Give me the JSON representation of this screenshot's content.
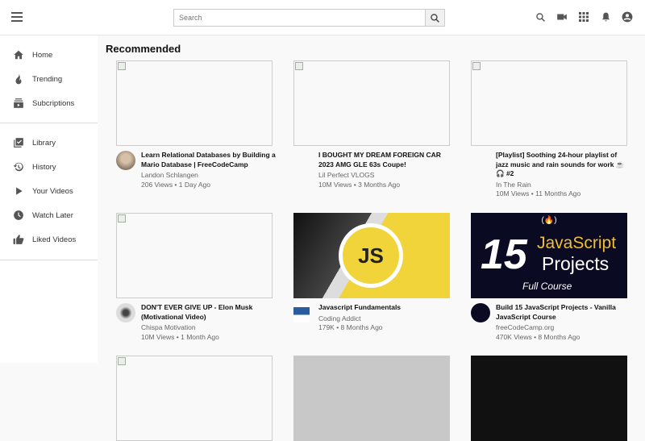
{
  "header": {
    "search_placeholder": "Search",
    "icons": [
      "menu-icon",
      "search-icon",
      "video-camera-icon",
      "apps-icon",
      "bell-icon",
      "account-icon"
    ]
  },
  "sidebar": {
    "primary": [
      {
        "label": "Home",
        "icon": "home-icon"
      },
      {
        "label": "Trending",
        "icon": "fire-icon"
      },
      {
        "label": "Subcriptions",
        "icon": "subscriptions-icon"
      }
    ],
    "secondary": [
      {
        "label": "Library",
        "icon": "library-icon"
      },
      {
        "label": "History",
        "icon": "history-icon"
      },
      {
        "label": "Your Videos",
        "icon": "play-icon"
      },
      {
        "label": "Watch Later",
        "icon": "clock-icon"
      },
      {
        "label": "Liked Videos",
        "icon": "thumbs-up-icon"
      }
    ]
  },
  "main": {
    "title": "Recommended",
    "videos": [
      {
        "title": "Learn Relational Databases by Building a Mario Database | FreeCodeCamp",
        "channel": "Landon Schlangen",
        "meta": "206 Views • 1 Day Ago"
      },
      {
        "title": "I BOUGHT MY DREAM FOREIGN CAR 2023 AMG GLE 63s Coupe!",
        "channel": "Lil Perfect VLOGS",
        "meta": "10M Views • 3 Months Ago"
      },
      {
        "title": "[Playlist] Soothing 24-hour playlist of jazz music and rain sounds for work ☕ 🎧 #2",
        "channel": "In The Rain",
        "meta": "10M Views • 11 Months Ago"
      },
      {
        "title": "DON'T EVER GIVE UP - Elon Musk (Motivational Video)",
        "channel": "Chispa Motivation",
        "meta": "10M Views • 1 Month Ago"
      },
      {
        "title": "Javascript Fundamentals",
        "channel": "Coding Addict",
        "meta": "179K • 8 Months Ago",
        "thumb_text": "JS"
      },
      {
        "title": "Build 15 JavaScript Projects - Vanilla JavaScript Course",
        "channel": "freeCodeCamp.org",
        "meta": "470K Views • 8 Months Ago",
        "thumb_text": {
          "num": "15",
          "line1": "JavaScript",
          "line2": "Projects",
          "sub": "Full Course",
          "logo": "(🔥)"
        }
      }
    ]
  }
}
